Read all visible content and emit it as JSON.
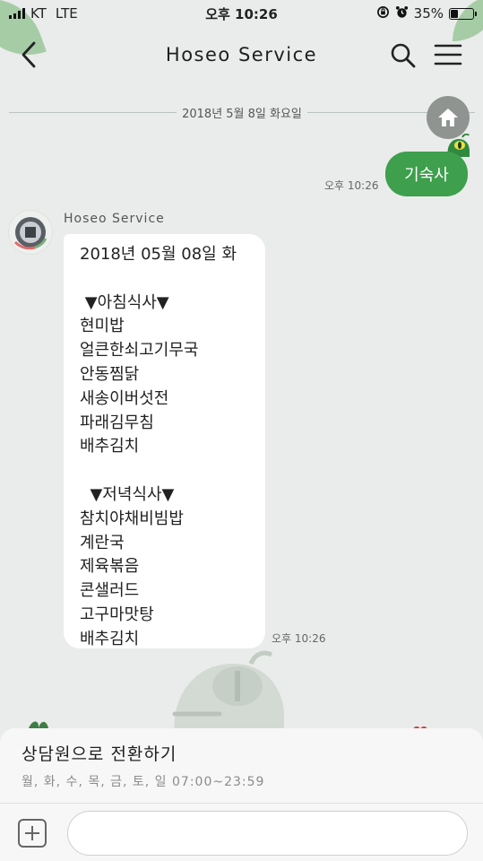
{
  "status_bar": {
    "carrier": "KT",
    "network": "LTE",
    "time": "오후 10:26",
    "battery_percent_label": "35%",
    "battery_level": 0.35
  },
  "header": {
    "title": "Hoseo Service"
  },
  "chat": {
    "date_divider": "2018년 5월 8일 화요일",
    "my_message": {
      "text": "기숙사",
      "time": "오후 10:26"
    },
    "bot": {
      "name": "Hoseo Service",
      "time": "오후 10:26",
      "lines": [
        "2018년 05월 08일 화",
        "",
        " ▼아침식사▼",
        "현미밥",
        "얼큰한쇠고기무국",
        "안동찜닭",
        "새송이버섯전",
        "파래김무침",
        "배추김치",
        "",
        "  ▼저녁식사▼",
        "참치야채비빔밥",
        "계란국",
        "제육볶음",
        "콘샐러드",
        "고구마맛탕",
        "배추김치"
      ]
    }
  },
  "consult": {
    "title": "상담원으로 전환하기",
    "hours": "월, 화, 수, 목, 금, 토, 일  07:00~23:59"
  },
  "colors": {
    "accent_green": "#3e9f4c",
    "background": "#e9ecea",
    "home_button": "#8f9491"
  }
}
